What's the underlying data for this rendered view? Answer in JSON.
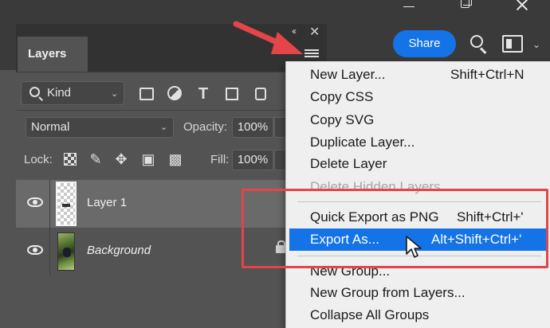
{
  "accent_color": "#1473e6",
  "annotation_color": "#e34548",
  "topbar": {
    "share_label": "Share",
    "icons": [
      "search-icon",
      "workspace-icon",
      "chevron-down-icon"
    ]
  },
  "window_controls": [
    "minimize-icon",
    "restore-icon",
    "close-icon"
  ],
  "panel": {
    "collapse_glyph": "‹‹",
    "close_glyph": "✕",
    "tab_label": "Layers",
    "filter": {
      "kind_label": "Kind",
      "icons": [
        "image-filter-icon",
        "adjustment-filter-icon",
        "type-filter-icon",
        "shape-filter-icon",
        "smart-object-filter-icon"
      ]
    },
    "blend_mode": "Normal",
    "opacity_label": "Opacity:",
    "opacity_value": "100%",
    "lock_label": "Lock:",
    "lock_icons": [
      "lock-pixels-icon",
      "lock-paint-icon",
      "lock-position-icon",
      "lock-artboard-icon",
      "lock-all-icon"
    ],
    "fill_label": "Fill:",
    "fill_value": "100%",
    "layers": [
      {
        "name": "Layer 1",
        "selected": true,
        "locked": false
      },
      {
        "name": "Background",
        "selected": false,
        "locked": true
      }
    ]
  },
  "menu": {
    "items": [
      {
        "label": "New Layer...",
        "shortcut": "Shift+Ctrl+N",
        "disabled": false
      },
      {
        "label": "Copy CSS",
        "shortcut": "",
        "disabled": false
      },
      {
        "label": "Copy SVG",
        "shortcut": "",
        "disabled": false
      },
      {
        "label": "Duplicate Layer...",
        "shortcut": "",
        "disabled": false
      },
      {
        "label": "Delete Layer",
        "shortcut": "",
        "disabled": false
      },
      {
        "label": "Delete Hidden Layers",
        "shortcut": "",
        "disabled": true
      },
      {
        "label": "Quick Export as PNG",
        "shortcut": "Shift+Ctrl+'",
        "disabled": false
      },
      {
        "label": "Export As...",
        "shortcut": "Alt+Shift+Ctrl+'",
        "disabled": false,
        "highlighted": true
      },
      {
        "label": "New Group...",
        "shortcut": "",
        "disabled": false
      },
      {
        "label": "New Group from Layers...",
        "shortcut": "",
        "disabled": false
      },
      {
        "label": "Collapse All Groups",
        "shortcut": "",
        "disabled": false
      }
    ]
  }
}
